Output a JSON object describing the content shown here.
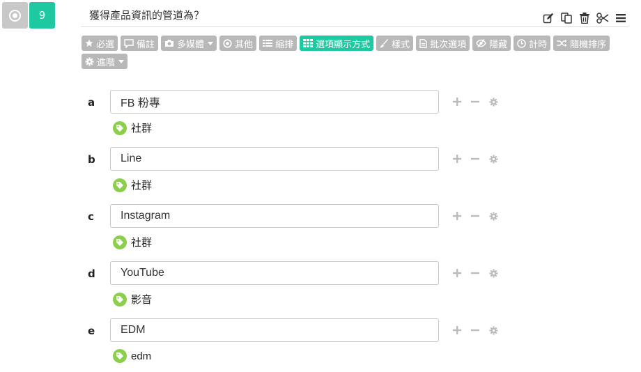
{
  "question": {
    "number": "9",
    "title": "獲得產品資訊的管道為？"
  },
  "question_actions": [
    {
      "name": "edit-icon"
    },
    {
      "name": "copy-icon"
    },
    {
      "name": "trash-icon"
    },
    {
      "name": "scissors-icon"
    },
    {
      "name": "menu-icon"
    }
  ],
  "toolbar": [
    {
      "label": "必選",
      "icon": "star-icon",
      "dropdown": false,
      "active": false
    },
    {
      "label": "備註",
      "icon": "comment-icon",
      "dropdown": false,
      "active": false
    },
    {
      "label": "多媒體",
      "icon": "camera-icon",
      "dropdown": true,
      "active": false
    },
    {
      "label": "其他",
      "icon": "dot-circle-icon",
      "dropdown": false,
      "active": false
    },
    {
      "label": "縮排",
      "icon": "list-icon",
      "dropdown": false,
      "active": false
    },
    {
      "label": "選項顯示方式",
      "icon": "grid-icon",
      "dropdown": false,
      "active": true
    },
    {
      "label": "樣式",
      "icon": "brush-icon",
      "dropdown": false,
      "active": false
    },
    {
      "label": "批次選項",
      "icon": "file-icon",
      "dropdown": false,
      "active": false
    },
    {
      "label": "隱藏",
      "icon": "eye-slash-icon",
      "dropdown": false,
      "active": false
    },
    {
      "label": "計時",
      "icon": "clock-icon",
      "dropdown": false,
      "active": false
    },
    {
      "label": "隨機排序",
      "icon": "shuffle-icon",
      "dropdown": false,
      "active": false
    },
    {
      "label": "進階",
      "icon": "gear-icon",
      "dropdown": true,
      "active": false
    }
  ],
  "options": [
    {
      "letter": "a",
      "value": "FB 粉專",
      "tag": "社群"
    },
    {
      "letter": "b",
      "value": "Line",
      "tag": "社群"
    },
    {
      "letter": "c",
      "value": "Instagram",
      "tag": "社群"
    },
    {
      "letter": "d",
      "value": "YouTube",
      "tag": "影音"
    },
    {
      "letter": "e",
      "value": "EDM",
      "tag": "edm"
    }
  ],
  "colors": {
    "accent": "#1ec8a0",
    "toolbar_button": "#b8b8b8",
    "tag": "#8ccf4d"
  }
}
